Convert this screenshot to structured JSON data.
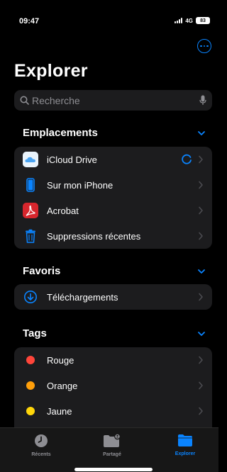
{
  "status": {
    "time": "09:47",
    "network": "4G",
    "battery": "83"
  },
  "header": {
    "title": "Explorer"
  },
  "search": {
    "placeholder": "Recherche"
  },
  "sections": {
    "locations": {
      "title": "Emplacements",
      "items": [
        {
          "label": "iCloud Drive",
          "icon": "icloud-icon"
        },
        {
          "label": "Sur mon iPhone",
          "icon": "iphone-icon"
        },
        {
          "label": "Acrobat",
          "icon": "acrobat-icon"
        },
        {
          "label": "Suppressions récentes",
          "icon": "trash-icon"
        }
      ]
    },
    "favorites": {
      "title": "Favoris",
      "items": [
        {
          "label": "Téléchargements",
          "icon": "download-icon"
        }
      ]
    },
    "tags": {
      "title": "Tags",
      "items": [
        {
          "label": "Rouge",
          "color": "#ff453a"
        },
        {
          "label": "Orange",
          "color": "#ff9f0a"
        },
        {
          "label": "Jaune",
          "color": "#ffd60a"
        }
      ]
    }
  },
  "tabbar": {
    "tabs": [
      {
        "label": "Récents",
        "icon": "clock-icon"
      },
      {
        "label": "Partagé",
        "icon": "shared-folder-icon"
      },
      {
        "label": "Explorer",
        "icon": "folder-icon"
      }
    ],
    "active": "Explorer"
  },
  "colors": {
    "accent": "#0a84ff",
    "background": "#000000",
    "group": "#1c1c1e"
  }
}
